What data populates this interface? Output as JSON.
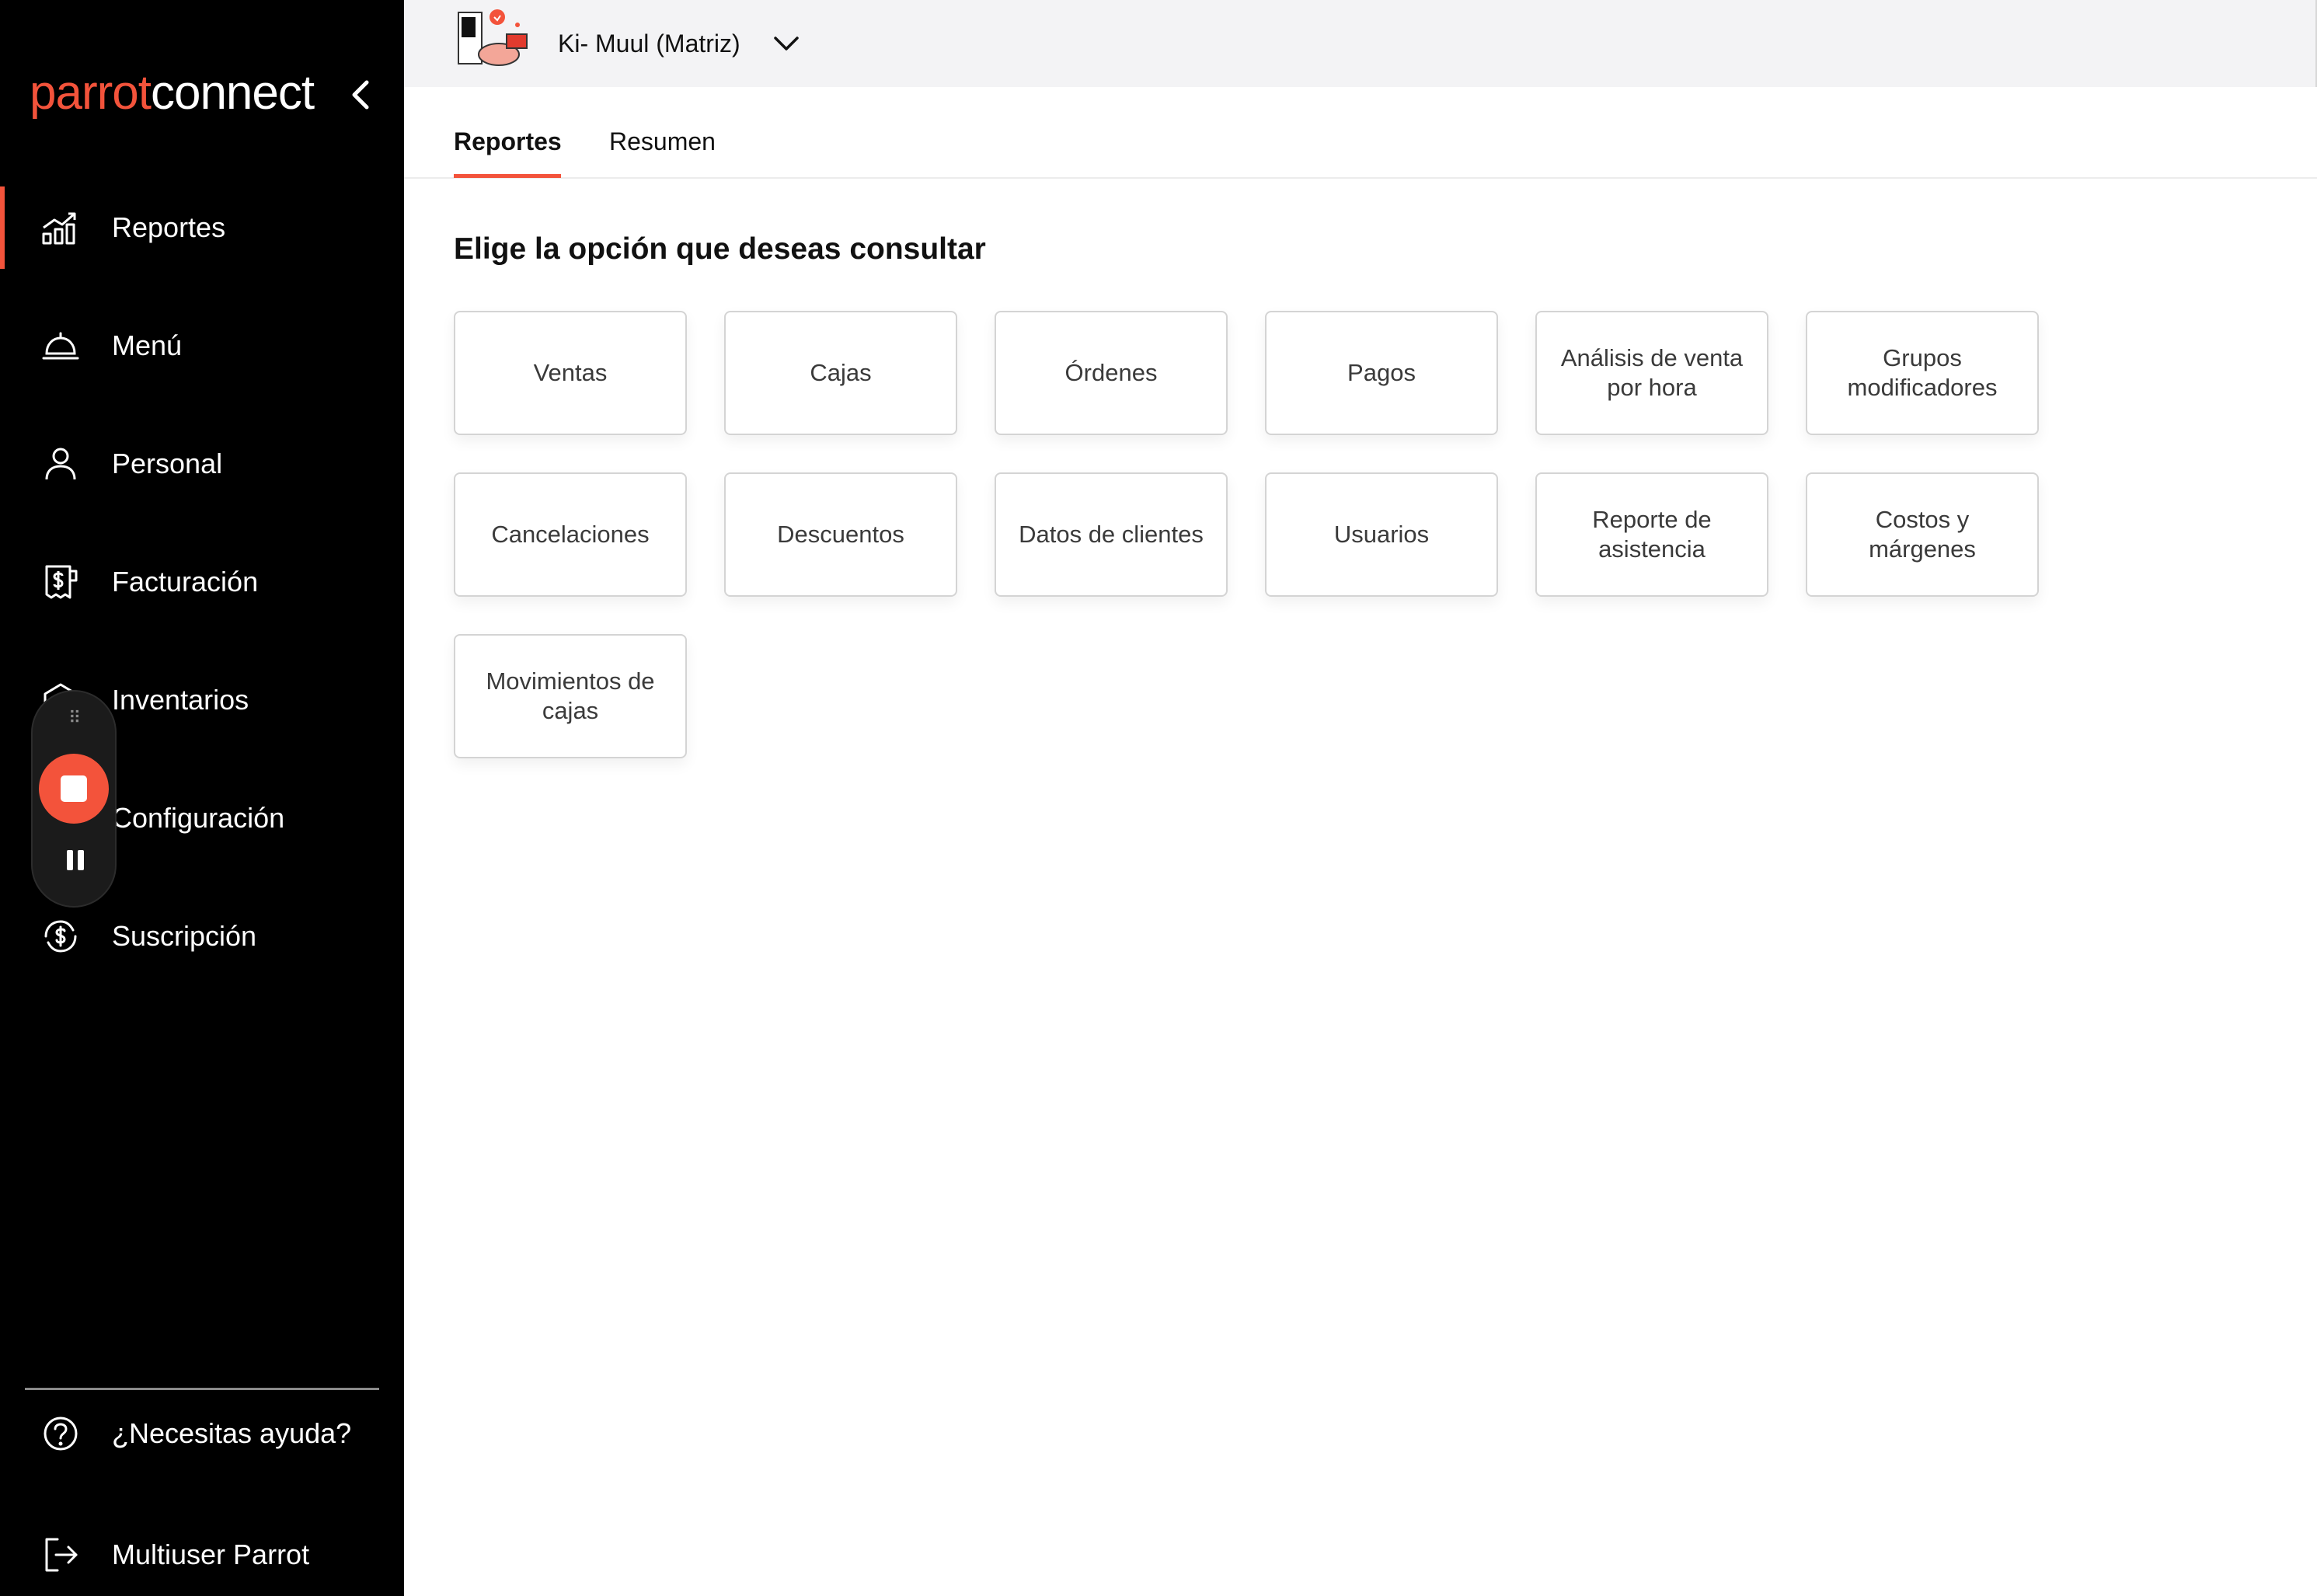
{
  "app": {
    "logo_part1": "parrot",
    "logo_part2": "connect",
    "brand_color": "#f3533b"
  },
  "sidebar": {
    "items": [
      {
        "label": "Reportes",
        "icon": "chart-bars-icon",
        "active": true
      },
      {
        "label": "Menú",
        "icon": "cloche-icon",
        "active": false
      },
      {
        "label": "Personal",
        "icon": "user-icon",
        "active": false
      },
      {
        "label": "Facturación",
        "icon": "receipt-dollar-icon",
        "active": false
      },
      {
        "label": "Inventarios",
        "icon": "inventory-icon",
        "active": false
      },
      {
        "label": "Configuración",
        "icon": "gear-icon",
        "active": false
      },
      {
        "label": "Suscripción",
        "icon": "dollar-cycle-icon",
        "active": false
      }
    ],
    "help_label": "¿Necesitas ayuda?",
    "user_label": "Multiuser Parrot"
  },
  "header": {
    "store_name": "Ki- Muul (Matriz)"
  },
  "tabs": [
    {
      "label": "Reportes",
      "active": true
    },
    {
      "label": "Resumen",
      "active": false
    }
  ],
  "main": {
    "heading": "Elige la opción que deseas consultar",
    "cards": [
      "Ventas",
      "Cajas",
      "Órdenes",
      "Pagos",
      "Análisis de venta por hora",
      "Grupos modificadores",
      "Cancelaciones",
      "Descuentos",
      "Datos de clientes",
      "Usuarios",
      "Reporte de asistencia",
      "Costos y márgenes",
      "Movimientos de cajas"
    ]
  }
}
